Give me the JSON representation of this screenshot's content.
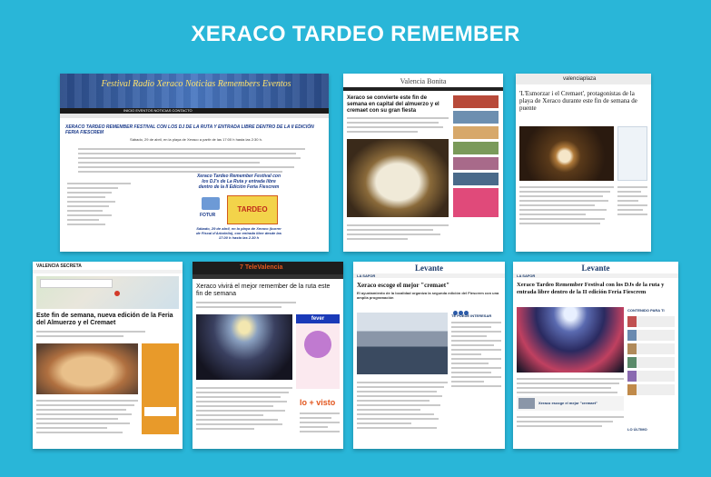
{
  "title": "XERACO TARDEO REMEMBER",
  "cards": {
    "c1": {
      "banner": "Festival Radio Xeraco Noticias Remembers Eventos",
      "nav": "INICIO  EVENTOS  NOTICIAS  CONTACTO",
      "headline": "XERACO TARDEO REMEMBER FESTIVAL CON LOS DJ DE LA RUTA Y ENTRADA LIBRE DENTRO DE LA II EDICIÓN FERIA FIESCREM",
      "subline": "Sábado, 29 de abril, en la playa de Xeraco a partir de las 17:00 h hasta las 2:30 h.",
      "poster_title": "Xeraco Tardeo Remember Festival con los DJ's de La Ruta y entrada libre dentro de la II Edición Feria Fiescrem",
      "poster_badge": "TARDEO",
      "poster_foot": "Sábado, 29 de abril, en la playa de Xeraco (burrer de Fiscal d'Arbolelia), con entrada libre desde las 17.00 h hasta las 2.30 h",
      "sponsor": "FOTUR"
    },
    "c2": {
      "logo": "Valencia Bonita",
      "headline": "Xeraco se convierte este fin de semana en capital del almuerzo y el cremaet con su gran fiesta"
    },
    "c3": {
      "logo": "valenciaplaza",
      "headline": "'L'Esmorzar i el Cremaet', protagonistas de la playa de Xeraco durante este fin de semana de puente"
    },
    "c4": {
      "logo": "VALENCIA SECRETA",
      "headline": "Este fin de semana, nueva edición de la Feria del Almuerzo y el Cremaet"
    },
    "c5": {
      "logo": "7 TeleValencia",
      "headline": "Xeraco vivirá el mejor remember de la ruta este fin de semana",
      "ad": "fever",
      "section": "lo + visto"
    },
    "c6": {
      "logo": "Levante",
      "section": "LA SAFOR",
      "headline": "Xeraco escoge el mejor \"cremaet\"",
      "sub": "El ayuntamiento de la localidad organiza la segunda edición del Fiescrem con una amplia programación",
      "aside": "TE PUEDE INTERESAR"
    },
    "c7": {
      "logo": "Levante",
      "section": "LA SAFOR",
      "headline": "Xeraco Tardeo Remember Festival con los DJs de la ruta y entrada libre dentro de la II edición Feria Fiescrem",
      "aside": "CONTENIDO PARA TI",
      "related": "Xeraco escoge el mejor \"cremaet\"",
      "foot": "LO ÚLTIMO"
    }
  },
  "colors": {
    "background": "#29b6d8",
    "levante_blue": "#1b3a6b",
    "televalencia_orange": "#e2561e"
  }
}
